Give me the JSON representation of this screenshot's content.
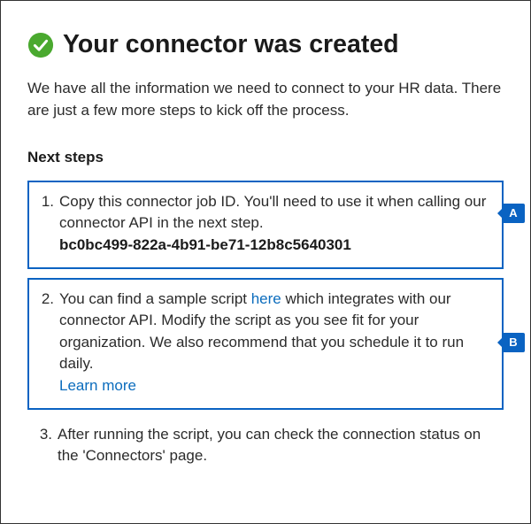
{
  "header": {
    "title": "Your connector was created"
  },
  "intro": "We have all the information we need to connect to your HR data. There are just a few more steps to kick off the process.",
  "next_steps_heading": "Next steps",
  "steps": {
    "s1": {
      "num": "1.",
      "text": "Copy this connector job ID. You'll need to use it when calling our connector API in the next step.",
      "job_id": "bc0bc499-822a-4b91-be71-12b8c5640301"
    },
    "s2": {
      "num": "2.",
      "text_pre": "You can find a sample script ",
      "link1": "here",
      "text_mid": " which integrates with our connector API. Modify the script as you see fit for your organization. We also recommend that you schedule it to run daily.",
      "link2": "Learn more"
    },
    "s3": {
      "num": "3.",
      "text": "After running the script, you can check the connection status on the 'Connectors' page."
    }
  },
  "callouts": {
    "a": "A",
    "b": "B"
  }
}
